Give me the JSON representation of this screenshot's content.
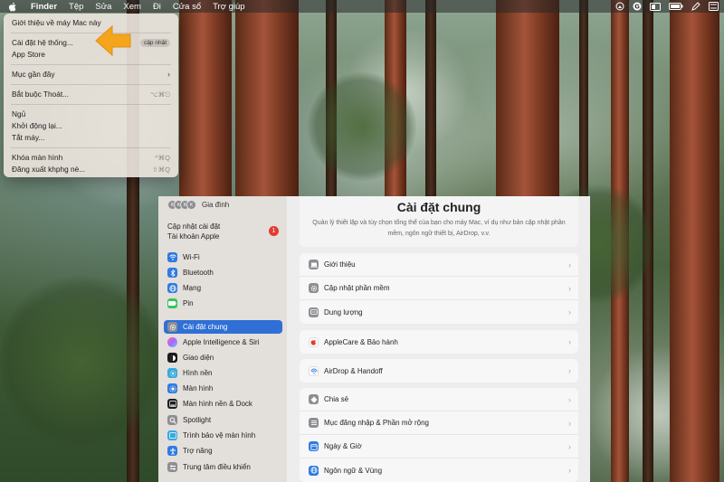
{
  "menubar": {
    "items": [
      "Finder",
      "Tệp",
      "Sửa",
      "Xem",
      "Đi",
      "Cửa sổ",
      "Trợ giúp"
    ],
    "icons": [
      "airplay-icon",
      "grammarly-icon",
      "display-icon",
      "battery-icon",
      "pen-icon",
      "control-center-icon"
    ]
  },
  "apple_menu": {
    "about": "Giới thiệu về máy Mac này",
    "settings": "Cài đặt hệ thống...",
    "settings_badge": "cập nhật",
    "appstore": "App Store",
    "recent": "Mục gần đây",
    "force_quit": "Bắt buộc Thoát...",
    "force_quit_sc": "⌥⌘⎋",
    "sleep": "Ngủ",
    "restart": "Khởi động lại...",
    "shutdown": "Tắt máy...",
    "lock": "Khóa màn hình",
    "lock_sc": "^⌘Q",
    "logout": "Đăng xuất khphg nè...",
    "logout_sc": "⇧⌘Q"
  },
  "sidebar": {
    "family_label": "Gia đình",
    "family_avatars": [
      "K",
      "K",
      "K",
      "K"
    ],
    "update_label": "Cập nhật cài đặt",
    "apple_account": "Tài khoản Apple",
    "update_count": "1",
    "items": [
      {
        "label": "Wi-Fi"
      },
      {
        "label": "Bluetooth"
      },
      {
        "label": "Mạng"
      },
      {
        "label": "Pin"
      },
      {
        "label": "Cài đặt chung"
      },
      {
        "label": "Apple Intelligence & Siri"
      },
      {
        "label": "Giao diện"
      },
      {
        "label": "Hình nền"
      },
      {
        "label": "Màn hình"
      },
      {
        "label": "Màn hình nền & Dock"
      },
      {
        "label": "Spotlight"
      },
      {
        "label": "Trình bảo vệ màn hình"
      },
      {
        "label": "Trợ năng"
      },
      {
        "label": "Trung tâm điều khiển"
      }
    ]
  },
  "content": {
    "title": "Cài đặt chung",
    "description": "Quản lý thiết lập và tùy chọn tổng thể của bạn cho máy Mac, ví dụ như bản cập nhật phần mềm, ngôn ngữ thiết bị, AirDrop, v.v.",
    "rows": {
      "about": "Giới thiệu",
      "software_update": "Cập nhật phần mềm",
      "storage": "Dung lượng",
      "applecare": "AppleCare & Bảo hành",
      "airdrop": "AirDrop & Handoff",
      "sharing": "Chia sẻ",
      "login_items": "Mục đăng nhập & Phần mở rộng",
      "date_time": "Ngày & Giờ",
      "language": "Ngôn ngữ & Vùng"
    }
  },
  "colors": {
    "accent": "#2f6fd6",
    "arrow": "#f4a51c",
    "badge_red": "#e33b33"
  }
}
